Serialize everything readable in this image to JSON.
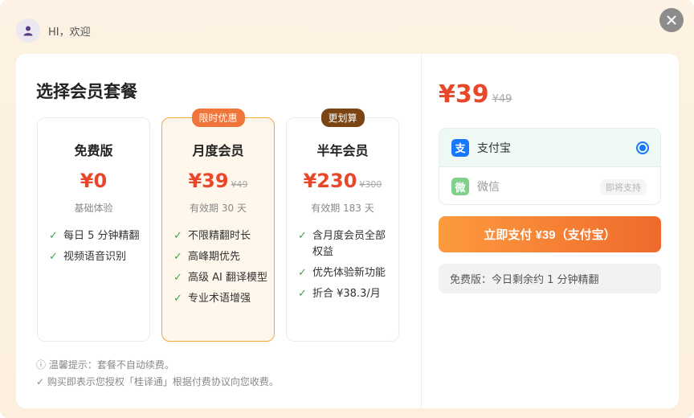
{
  "header": {
    "greeting": "HI，欢迎"
  },
  "title": "选择会员套餐",
  "plans": [
    {
      "name": "免费版",
      "price": "¥0",
      "old_price": "",
      "subtitle": "基础体验",
      "tag": "",
      "features": [
        "每日 5 分钟精翻",
        "视频语音识别"
      ]
    },
    {
      "name": "月度会员",
      "price": "¥39",
      "old_price": "¥49",
      "subtitle": "有效期 30 天",
      "tag": "限时优惠",
      "features": [
        "不限精翻时长",
        "高峰期优先",
        "高级 AI 翻译模型",
        "专业术语增强"
      ]
    },
    {
      "name": "半年会员",
      "price": "¥230",
      "old_price": "¥300",
      "subtitle": "有效期 183 天",
      "tag": "更划算",
      "features": [
        "含月度会员全部权益",
        "优先体验新功能",
        "折合 ¥38.3/月"
      ]
    }
  ],
  "tips": {
    "line1": "ⓘ 温馨提示：套餐不自动续费。",
    "line2": "✓ 购买即表示您授权「桂译通」根据付费协议向您收费。"
  },
  "payment": {
    "price": "¥39",
    "old_price": "¥49",
    "methods": [
      {
        "label": "支付宝",
        "icon_char": "支",
        "icon_color": "#1677ff",
        "selected": true,
        "note": ""
      },
      {
        "label": "微信",
        "icon_char": "微",
        "icon_color": "#7fd08a",
        "selected": false,
        "note": "即将支持"
      }
    ],
    "pay_button": "立即支付 ¥39（支付宝）",
    "free_note": "免费版：今日剩余约 1 分钟精翻"
  },
  "colors": {
    "accent": "#e9472a",
    "selected_border": "#f4a63a",
    "check": "#3fa74a",
    "radio": "#1677ff"
  }
}
